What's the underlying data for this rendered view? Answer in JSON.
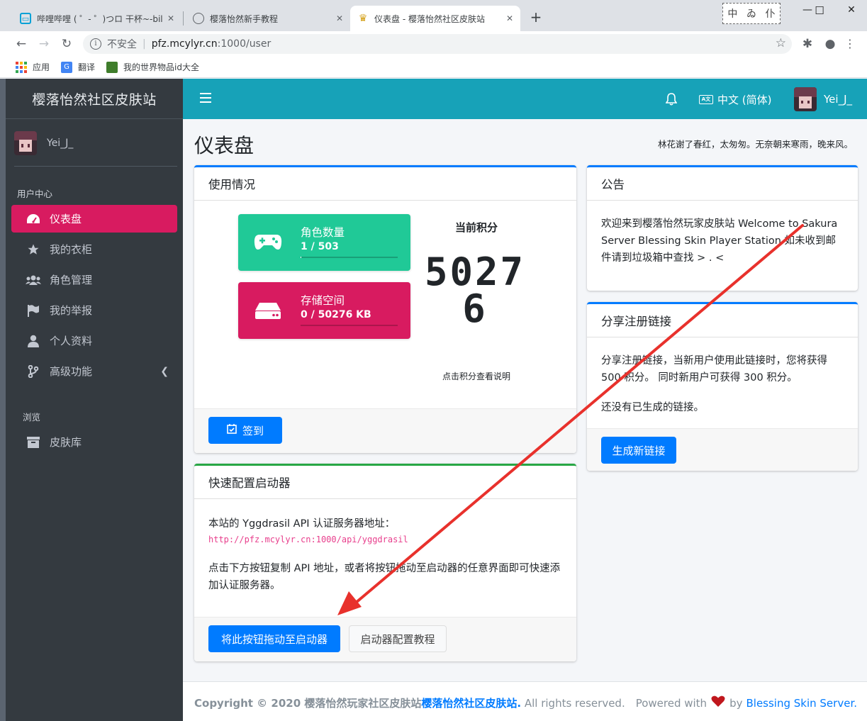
{
  "browser": {
    "tabs": [
      {
        "title": "哔哩哔哩 ( ゜- ゜)つロ 干杯~-bili"
      },
      {
        "title": "樱落怡然新手教程"
      },
      {
        "title": "仪表盘 - 樱落怡然社区皮肤站"
      }
    ],
    "ime": [
      "中",
      "ゐ",
      "仆"
    ],
    "address": {
      "security": "不安全",
      "host": "pfz.mcylyr.cn",
      "path": ":1000/user"
    },
    "bookmarks": [
      "应用",
      "翻译",
      "我的世界物品id大全"
    ]
  },
  "sidebar": {
    "brand": "樱落怡然社区皮肤站",
    "username": "Yei_J_",
    "section_user": "用户中心",
    "items": [
      {
        "label": "仪表盘",
        "icon": "dashboard-icon"
      },
      {
        "label": "我的衣柜",
        "icon": "star-icon"
      },
      {
        "label": "角色管理",
        "icon": "users-icon"
      },
      {
        "label": "我的举报",
        "icon": "flag-icon"
      },
      {
        "label": "个人资料",
        "icon": "user-icon"
      },
      {
        "label": "高级功能",
        "icon": "branch-icon"
      }
    ],
    "section_browse": "浏览",
    "browse_items": [
      {
        "label": "皮肤库",
        "icon": "archive-icon"
      }
    ]
  },
  "navbar": {
    "language": "中文 (简体)",
    "username": "Yei_J_"
  },
  "page": {
    "title": "仪表盘",
    "quote": "林花谢了春红，太匆匆。无奈朝来寒雨，晚来风。"
  },
  "usage": {
    "title": "使用情况",
    "players": {
      "label": "角色数量",
      "value": "1 / 503",
      "fraction": 0.002
    },
    "storage": {
      "label": "存储空间",
      "value": "0 / 50276 KB",
      "fraction": 0
    },
    "score_title": "当前积分",
    "score": "50276",
    "score_hint": "点击积分查看说明",
    "sign_button": "签到"
  },
  "launcher": {
    "title": "快速配置启动器",
    "intro": "本站的 Yggdrasil API 认证服务器地址：",
    "api_url": "http://pfz.mcylyr.cn:1000/api/yggdrasil",
    "desc": "点击下方按钮复制 API 地址，或者将按钮拖动至启动器的任意界面即可快速添加认证服务器。",
    "drag_button": "将此按钮拖动至启动器",
    "tutorial_button": "启动器配置教程"
  },
  "announcement": {
    "title": "公告",
    "text": "欢迎来到樱落怡然玩家皮肤站 Welcome to Sakura Server Blessing Skin Player Station 如未收到邮件请到垃圾箱中查找 > . <"
  },
  "invite": {
    "title": "分享注册链接",
    "text": "分享注册链接，当新用户使用此链接时，您将获得 500 积分。 同时新用户可获得 300 积分。",
    "empty": "还没有已生成的链接。",
    "button": "生成新链接"
  },
  "footer": {
    "copyright_prefix": "Copyright © 2020 樱落怡然玩家社区皮肤站",
    "site_name": "樱落怡然社区皮肤站.",
    "rights": " All rights reserved.",
    "powered_prefix": "Powered with",
    "powered_suffix": "by",
    "powered_link": "Blessing Skin Server."
  },
  "colors": {
    "navbar": "#17a2b8",
    "active_item": "#d81b60",
    "players_box": "#20c997",
    "storage_box": "#d81b60",
    "primary": "#007bff",
    "annotation_arrow": "#e8312c"
  }
}
